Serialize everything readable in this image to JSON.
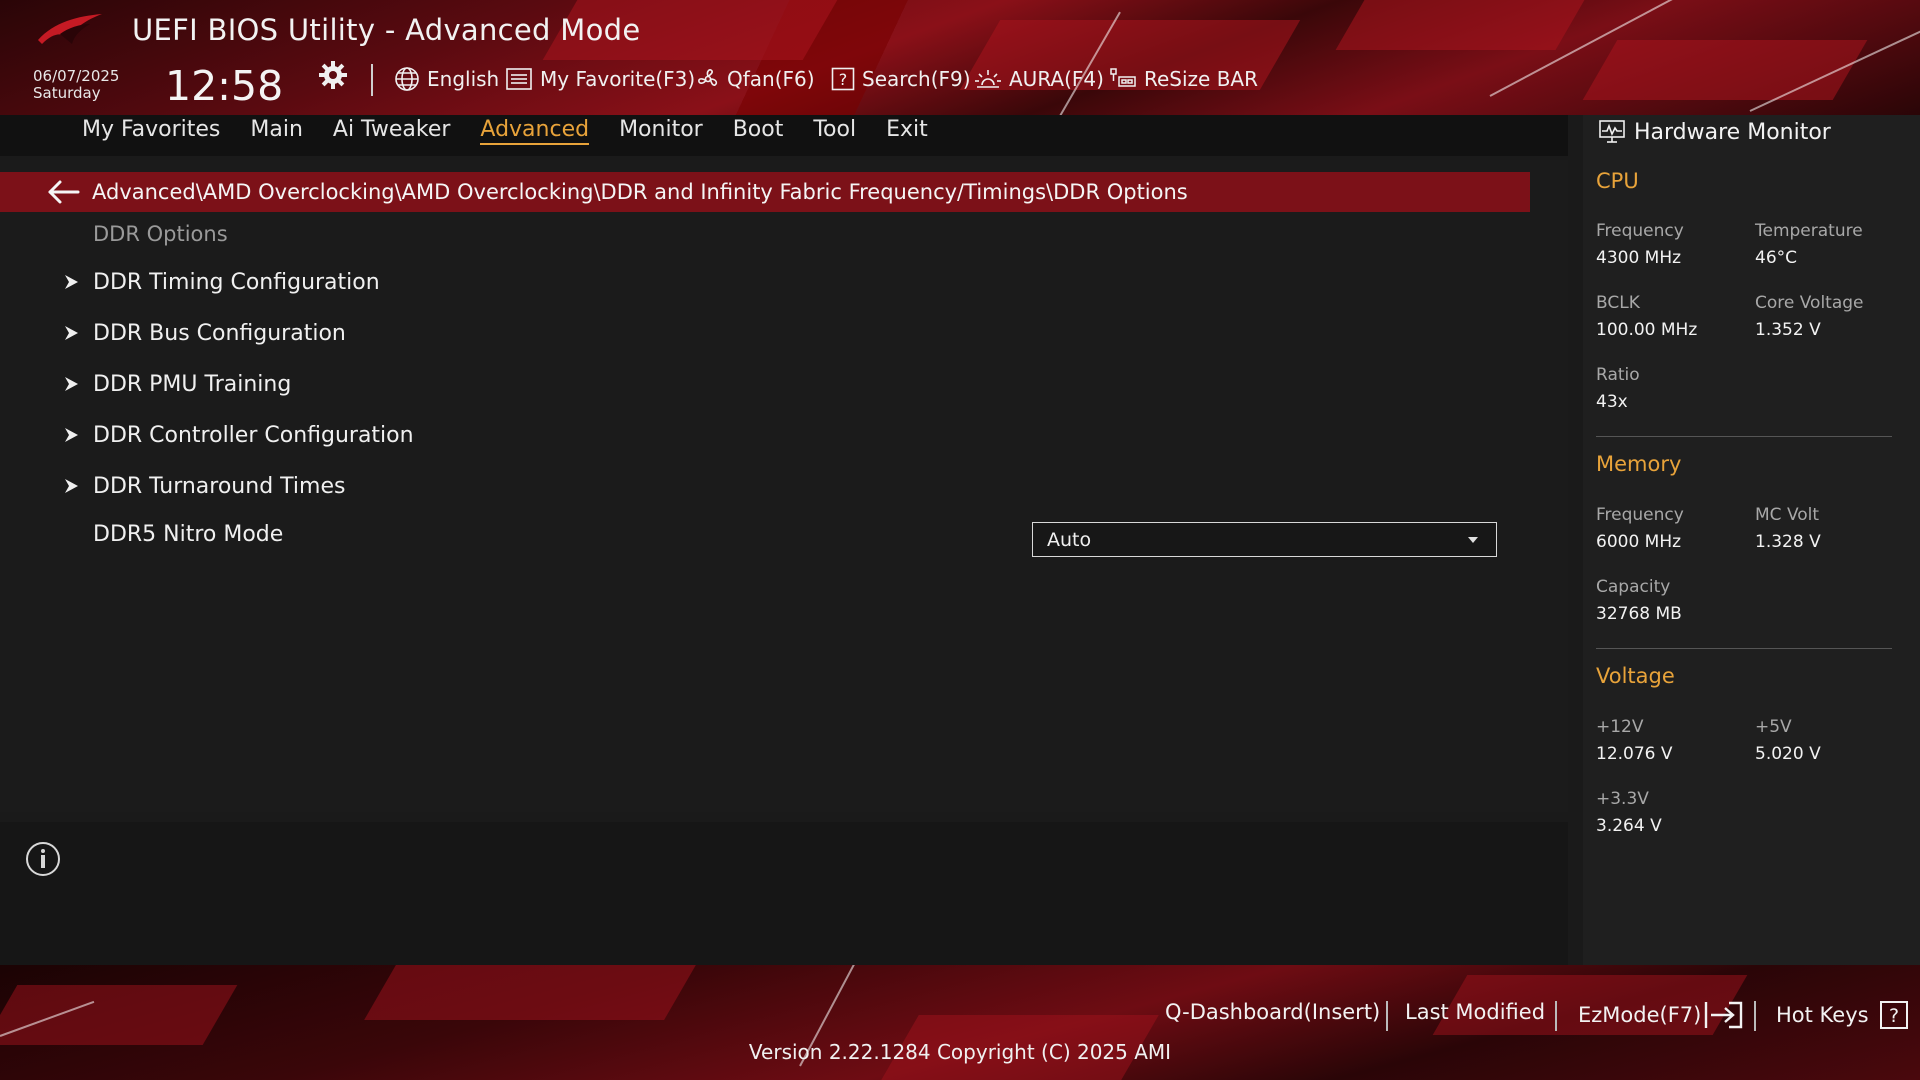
{
  "header": {
    "title": "UEFI BIOS Utility - Advanced Mode",
    "date": "06/07/2025",
    "day": "Saturday",
    "time": "12:58",
    "toolbar": {
      "language": "English",
      "favorite": "My Favorite(F3)",
      "qfan": "Qfan(F6)",
      "search": "Search(F9)",
      "aura": "AURA(F4)",
      "resize": "ReSize BAR"
    }
  },
  "tabs": [
    {
      "label": "My Favorites"
    },
    {
      "label": "Main"
    },
    {
      "label": "Ai Tweaker"
    },
    {
      "label": "Advanced",
      "active": true
    },
    {
      "label": "Monitor"
    },
    {
      "label": "Boot"
    },
    {
      "label": "Tool"
    },
    {
      "label": "Exit"
    }
  ],
  "breadcrumb": "Advanced\\AMD Overclocking\\AMD Overclocking\\DDR and Infinity Fabric Frequency/Timings\\DDR Options",
  "section_title": "DDR Options",
  "menu": [
    {
      "label": "DDR Timing Configuration"
    },
    {
      "label": "DDR Bus Configuration"
    },
    {
      "label": "DDR PMU Training"
    },
    {
      "label": "DDR Controller Configuration"
    },
    {
      "label": "DDR Turnaround Times"
    }
  ],
  "setting": {
    "label": "DDR5 Nitro Mode",
    "value": "Auto"
  },
  "hardware_monitor": {
    "title": "Hardware Monitor",
    "cpu": {
      "heading": "CPU",
      "frequency_label": "Frequency",
      "frequency": "4300 MHz",
      "temperature_label": "Temperature",
      "temperature": "46°C",
      "bclk_label": "BCLK",
      "bclk": "100.00 MHz",
      "core_voltage_label": "Core Voltage",
      "core_voltage": "1.352 V",
      "ratio_label": "Ratio",
      "ratio": "43x"
    },
    "memory": {
      "heading": "Memory",
      "frequency_label": "Frequency",
      "frequency": "6000 MHz",
      "mc_volt_label": "MC Volt",
      "mc_volt": "1.328 V",
      "capacity_label": "Capacity",
      "capacity": "32768 MB"
    },
    "voltage": {
      "heading": "Voltage",
      "v12_label": "+12V",
      "v12": "12.076 V",
      "v5_label": "+5V",
      "v5": "5.020 V",
      "v33_label": "+3.3V",
      "v33": "3.264 V"
    }
  },
  "footer": {
    "qdashboard": "Q-Dashboard(Insert)",
    "last_modified": "Last Modified",
    "ezmode": "EzMode(F7)",
    "hotkeys": "Hot Keys",
    "version": "Version 2.22.1284 Copyright (C) 2025 AMI"
  },
  "colors": {
    "accent": "#e8a33a",
    "breadcrumb_bg": "#7c1118",
    "panel_bg": "#1b1b1b"
  }
}
